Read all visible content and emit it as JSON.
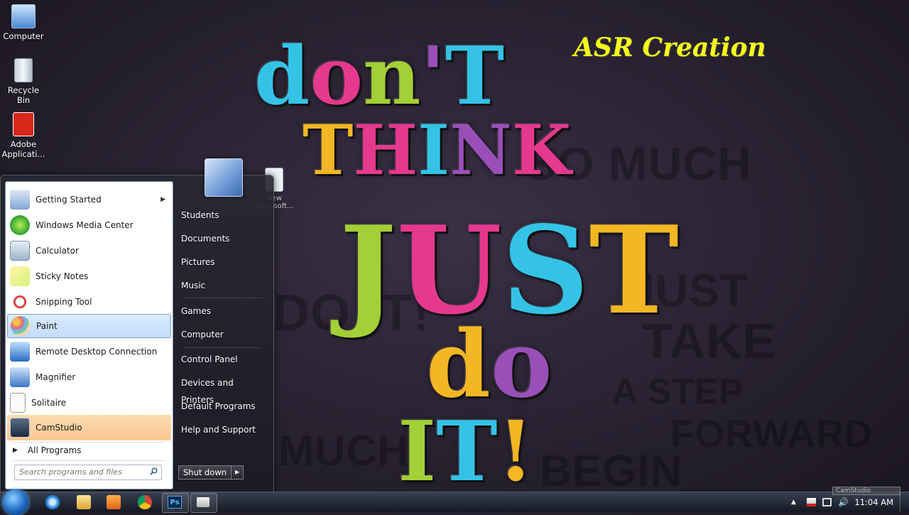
{
  "wallpaper": {
    "words": [
      "don't",
      "THINK",
      "JUST",
      "do",
      "IT!"
    ],
    "bg_words": [
      "SO MUCH",
      "JUST",
      "TAKE",
      "A STEP",
      "FORWARD",
      "DO IT!",
      "MUCH",
      "BEGIN"
    ],
    "watermark": "ASR Creation"
  },
  "desktop": {
    "icons": [
      {
        "label": "Computer"
      },
      {
        "label": "Recycle Bin"
      },
      {
        "label": "Adobe Applicati..."
      },
      {
        "label": "New Microsoft..."
      }
    ]
  },
  "start_menu": {
    "programs": [
      {
        "label": "Getting Started",
        "has_submenu": true
      },
      {
        "label": "Windows Media Center"
      },
      {
        "label": "Calculator"
      },
      {
        "label": "Sticky Notes"
      },
      {
        "label": "Snipping Tool"
      },
      {
        "label": "Paint",
        "selected": true
      },
      {
        "label": "Remote Desktop Connection"
      },
      {
        "label": "Magnifier"
      },
      {
        "label": "Solitaire"
      },
      {
        "label": "CamStudio",
        "highlighted": true
      }
    ],
    "all_programs": "All Programs",
    "search_placeholder": "Search programs and files",
    "places": [
      "Students",
      "Documents",
      "Pictures",
      "Music",
      "Games",
      "Computer",
      "Control Panel",
      "Devices and Printers",
      "Default Programs",
      "Help and Support"
    ],
    "shutdown_label": "Shut down"
  },
  "taskbar": {
    "pinned": [
      "internet-explorer",
      "windows-explorer",
      "media-player",
      "chrome",
      "photoshop",
      "camstudio"
    ],
    "photoshop_label": "Ps",
    "clock": "11:04 AM",
    "preview_label": "CamStudio"
  },
  "colors": {
    "watermark": "#f6ff1a",
    "selected_item": "#c1dcfb",
    "highlight_item": "#fbc890",
    "letter_palette": [
      "#34c3e6",
      "#e4398e",
      "#a3cf37",
      "#f3b624",
      "#9a4fb8"
    ]
  }
}
